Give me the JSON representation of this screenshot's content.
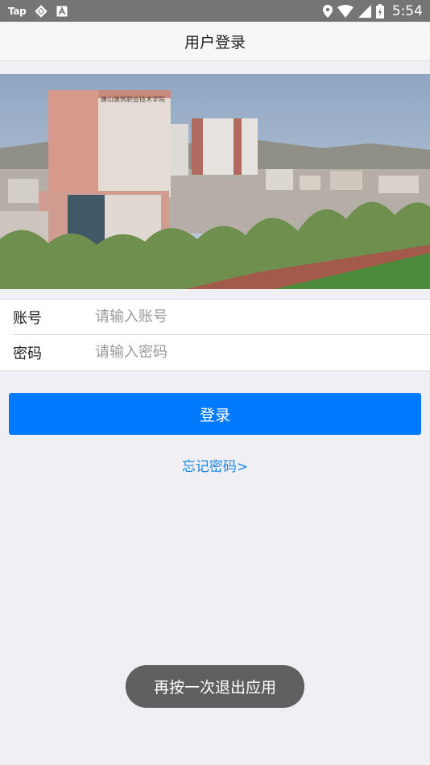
{
  "status_bar": {
    "left_app_label": "Tap",
    "time": "5:54",
    "icons": [
      "tap-app-icon",
      "sync-icon",
      "a-app-icon",
      "location-icon",
      "wifi-icon",
      "signal-icon",
      "battery-icon"
    ]
  },
  "header": {
    "title": "用户登录"
  },
  "banner": {
    "sign_text": "唐山建筑职业技术学院",
    "description": "campus photo"
  },
  "form": {
    "account": {
      "label": "账号",
      "placeholder": "请输入账号",
      "value": ""
    },
    "password": {
      "label": "密码",
      "placeholder": "请输入密码",
      "value": ""
    }
  },
  "actions": {
    "login_label": "登录",
    "forgot_label": "忘记密码>"
  },
  "toast": {
    "message": "再按一次退出应用"
  },
  "colors": {
    "primary": "#007aff",
    "link": "#1a87e6",
    "background": "#efeff4",
    "status_bar": "#757575",
    "toast": "#606060"
  }
}
